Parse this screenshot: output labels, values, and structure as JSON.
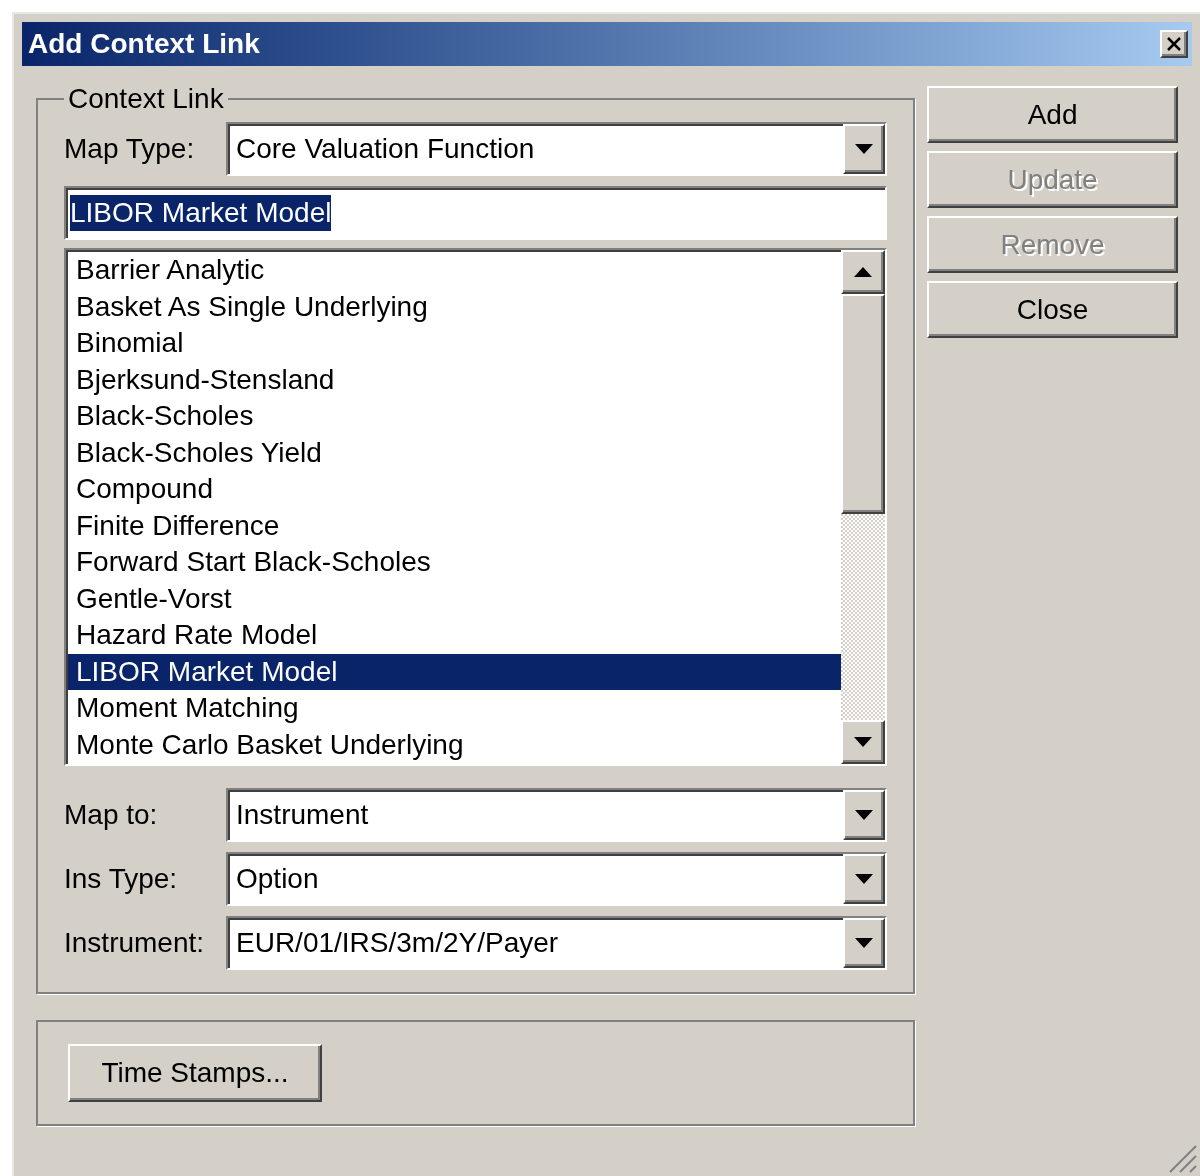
{
  "window": {
    "title": "Add Context Link"
  },
  "context_link": {
    "legend": "Context Link",
    "map_type": {
      "label": "Map Type:",
      "value": "Core Valuation Function"
    },
    "name_field": {
      "value": "LIBOR Market Model",
      "text_selected": true
    },
    "list": {
      "items": [
        {
          "label": "Barrier Analytic",
          "selected": false
        },
        {
          "label": "Basket As Single Underlying",
          "selected": false
        },
        {
          "label": "Binomial",
          "selected": false
        },
        {
          "label": "Bjerksund-Stensland",
          "selected": false
        },
        {
          "label": "Black-Scholes",
          "selected": false
        },
        {
          "label": "Black-Scholes Yield",
          "selected": false
        },
        {
          "label": "Compound",
          "selected": false
        },
        {
          "label": "Finite Difference",
          "selected": false
        },
        {
          "label": "Forward Start Black-Scholes",
          "selected": false
        },
        {
          "label": "Gentle-Vorst",
          "selected": false
        },
        {
          "label": "Hazard Rate Model",
          "selected": false
        },
        {
          "label": "LIBOR Market Model",
          "selected": true
        },
        {
          "label": "Moment Matching",
          "selected": false
        },
        {
          "label": "Monte Carlo Basket Underlying",
          "selected": false
        }
      ]
    },
    "fields": [
      {
        "label": "Map to:",
        "value": "Instrument"
      },
      {
        "label": "Ins Type:",
        "value": "Option"
      },
      {
        "label": "Instrument:",
        "value": "EUR/01/IRS/3m/2Y/Payer"
      }
    ]
  },
  "time_stamps_button": {
    "label": "Time Stamps..."
  },
  "buttons": [
    {
      "label": "Add",
      "disabled": false
    },
    {
      "label": "Update",
      "disabled": true
    },
    {
      "label": "Remove",
      "disabled": true
    },
    {
      "label": "Close",
      "disabled": false
    }
  ]
}
